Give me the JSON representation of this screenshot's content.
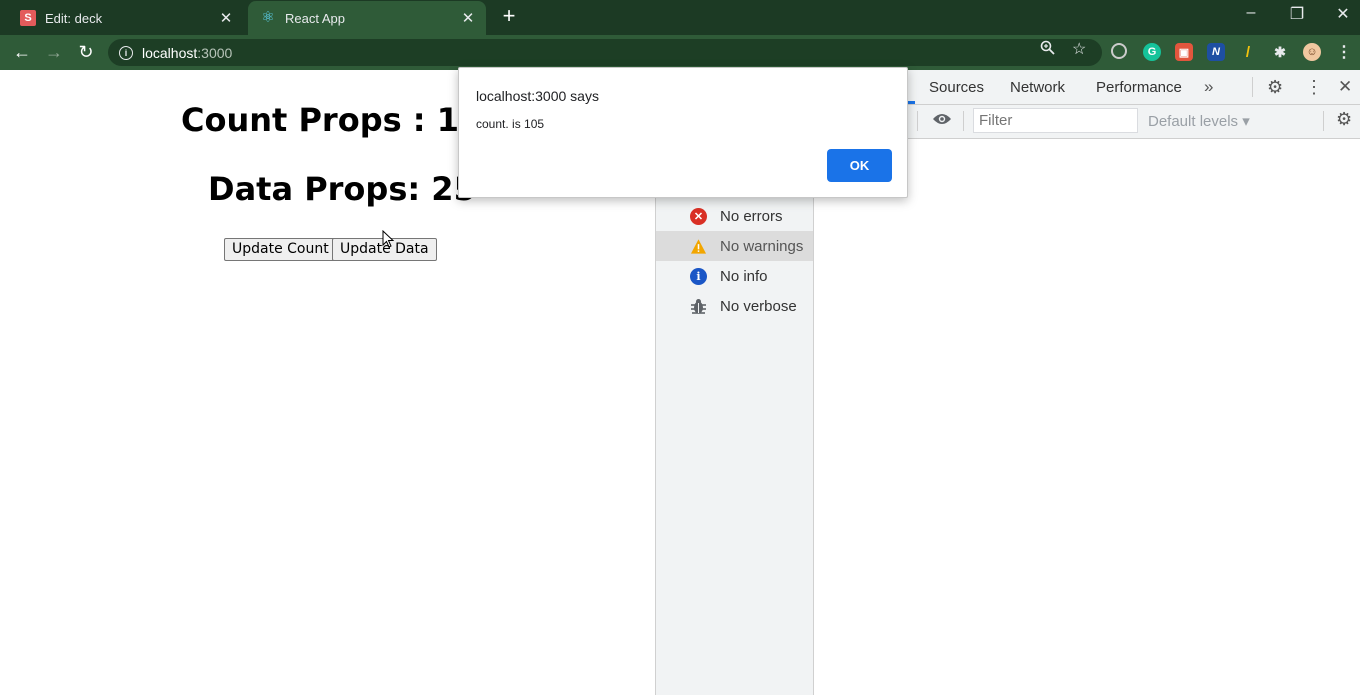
{
  "tabs": [
    {
      "title": "Edit: deck",
      "favicon": "S"
    },
    {
      "title": "React App",
      "favicon": "⚛"
    }
  ],
  "address": {
    "host": "localhost",
    "port": ":3000"
  },
  "page": {
    "count_heading": "Count Props : 105",
    "data_heading": "Data Props: 25",
    "update_count_label": "Update Count",
    "update_data_label": "Update Data"
  },
  "devtools": {
    "tabs": [
      "Sources",
      "Network",
      "Performance"
    ],
    "filter_placeholder": "Filter",
    "levels_label": "Default levels ▾",
    "sidebar": [
      {
        "label": "No errors",
        "icon": "error-icon",
        "color": "#d93025"
      },
      {
        "label": "No warnings",
        "icon": "warning-icon",
        "color": "#f2a600"
      },
      {
        "label": "No info",
        "icon": "info-icon",
        "color": "#1a56c6"
      },
      {
        "label": "No verbose",
        "icon": "bug-icon",
        "color": "#5f6368"
      }
    ]
  },
  "dialog": {
    "title": "localhost:3000 says",
    "message": "count. is 105",
    "ok_label": "OK"
  },
  "colors": {
    "tabbar": "#1c3a24",
    "toolbar": "#2f5b38",
    "accent": "#1a73e8"
  }
}
